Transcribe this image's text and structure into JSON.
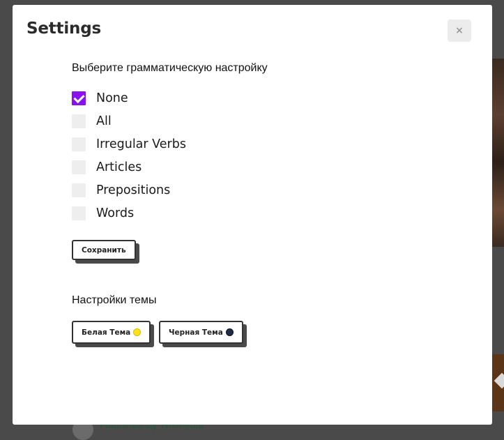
{
  "background": {
    "published_text": "Published by WikiPedia"
  },
  "modal": {
    "title": "Settings",
    "close_label": "×",
    "grammar_heading": "Выберите грамматическую настройку",
    "options": [
      {
        "label": "None",
        "checked": true
      },
      {
        "label": "All",
        "checked": false
      },
      {
        "label": "Irregular Verbs",
        "checked": false
      },
      {
        "label": "Articles",
        "checked": false
      },
      {
        "label": "Prepositions",
        "checked": false
      },
      {
        "label": "Words",
        "checked": false
      }
    ],
    "save_label": "Сохранить",
    "theme_heading": "Настройки темы",
    "theme_buttons": {
      "light_label": "Белая Тема",
      "light_icon": "sun-icon",
      "dark_label": "Черная Тема",
      "dark_icon": "moon-icon"
    }
  },
  "colors": {
    "accent": "#8a10f0",
    "overlay": "#4a4a4a",
    "checkbox_unchecked": "#eeeeee",
    "sun": "#ffe21a",
    "moon": "#1f2a44"
  }
}
